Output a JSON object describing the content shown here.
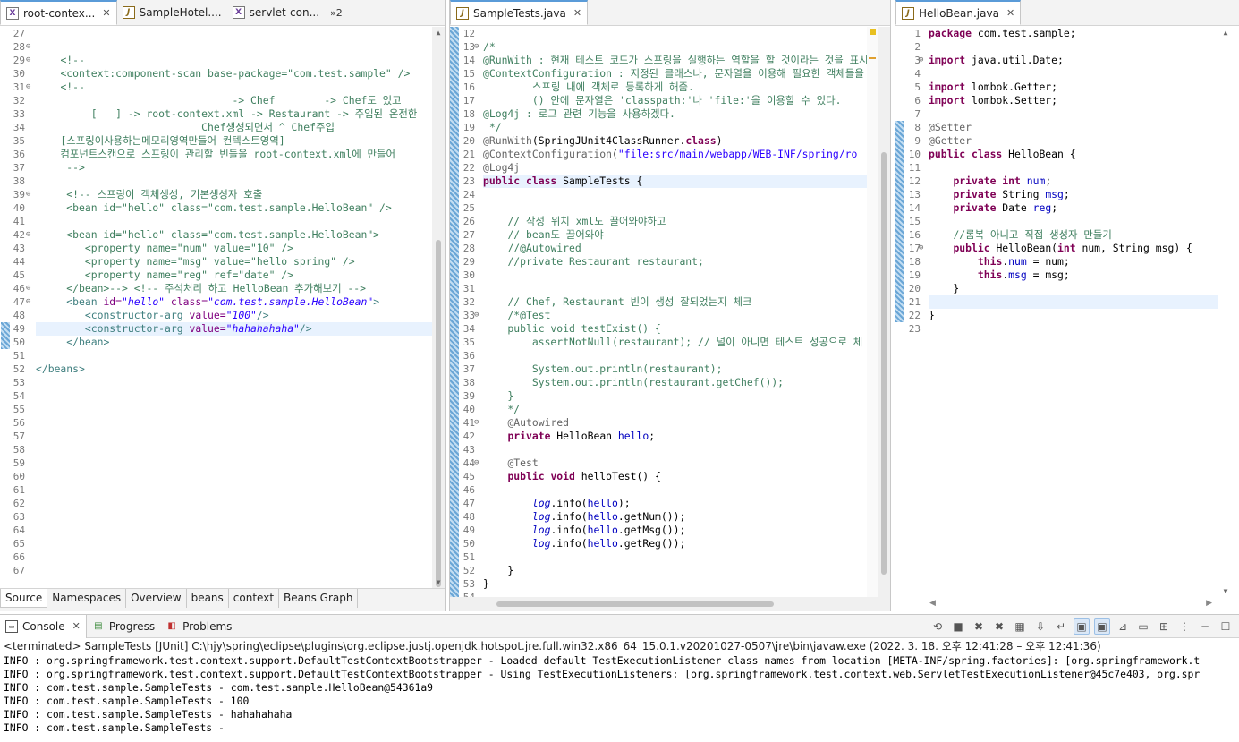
{
  "left_editor": {
    "tabs": [
      {
        "label": "root-contex...",
        "icon": "xml-file-icon",
        "active": true
      },
      {
        "label": "SampleHotel....",
        "icon": "java-file-icon",
        "active": false
      },
      {
        "label": "servlet-con...",
        "icon": "xml-file-icon",
        "active": false
      }
    ],
    "overflow_label": "»2",
    "bottom_tabs": [
      "Source",
      "Namespaces",
      "Overview",
      "beans",
      "context",
      "Beans Graph"
    ],
    "lines": [
      {
        "n": "27",
        "fold": false,
        "html": ""
      },
      {
        "n": "28",
        "fold": true,
        "html": ""
      },
      {
        "n": "29",
        "fold": true,
        "html": "    <span class='c-comment'>&lt;!--</span>"
      },
      {
        "n": "30",
        "fold": false,
        "html": "    <span class='c-comment'>&lt;context:component-scan base-package=\"com.test.sample\" /&gt;</span>"
      },
      {
        "n": "31",
        "fold": true,
        "html": "    <span class='c-comment'>&lt;!--</span>"
      },
      {
        "n": "32",
        "fold": false,
        "html": "<span class='c-comment'>                                -&gt; Chef        -&gt; Chef도 있고</span>"
      },
      {
        "n": "33",
        "fold": false,
        "html": "<span class='c-comment'>         [   ] -&gt; root-context.xml -&gt; Restaurant -&gt; 주입된 온전한</span>"
      },
      {
        "n": "34",
        "fold": false,
        "html": "<span class='c-comment'>                           Chef생성되면서 ^ Chef주입</span>"
      },
      {
        "n": "35",
        "fold": false,
        "html": "<span class='c-comment'>    [스프링이사용하는메모리영역만들어 컨텍스트영역]</span>"
      },
      {
        "n": "36",
        "fold": false,
        "html": "<span class='c-comment'>    컴포넌트스캔으로 스프링이 관리할 빈들을 root-context.xml에 만들어</span>"
      },
      {
        "n": "37",
        "fold": false,
        "html": "<span class='c-comment'>     --&gt;</span>"
      },
      {
        "n": "38",
        "fold": false,
        "html": ""
      },
      {
        "n": "39",
        "fold": true,
        "html": "     <span class='c-comment'>&lt;!-- 스프링이 객체생성, 기본생성자 호출</span>"
      },
      {
        "n": "40",
        "fold": false,
        "html": "<span class='c-comment'>     &lt;bean id=\"hello\" class=\"com.test.sample.HelloBean\" /&gt;</span>"
      },
      {
        "n": "41",
        "fold": false,
        "html": ""
      },
      {
        "n": "42",
        "fold": true,
        "html": "<span class='c-comment'>     &lt;bean id=\"hello\" class=\"com.test.sample.HelloBean\"&gt;</span>"
      },
      {
        "n": "43",
        "fold": false,
        "html": "<span class='c-comment'>        &lt;property name=\"num\" value=\"10\" /&gt;</span>"
      },
      {
        "n": "44",
        "fold": false,
        "html": "<span class='c-comment'>        &lt;property name=\"msg\" value=\"hello spring\" /&gt;</span>"
      },
      {
        "n": "45",
        "fold": false,
        "html": "<span class='c-comment'>        &lt;property name=\"reg\" ref=\"date\" /&gt;</span>"
      },
      {
        "n": "46",
        "fold": true,
        "html": "<span class='c-comment'>     &lt;/bean&gt;--&gt; &lt;!-- 주석처리 하고 HelloBean 추가해보기 --&gt;</span>"
      },
      {
        "n": "47",
        "fold": true,
        "html": "     <span class='c-tag'>&lt;bean</span> <span class='c-attr'>id=</span><span class='c-stri'>\"hello\"</span> <span class='c-attr'>class=</span><span class='c-stri'>\"com.test.sample.HelloBean\"</span><span class='c-tag'>&gt;</span>"
      },
      {
        "n": "48",
        "fold": false,
        "html": "        <span class='c-tag'>&lt;constructor-arg</span> <span class='c-attr'>value=</span><span class='c-stri'>\"100\"</span><span class='c-tag'>/&gt;</span>"
      },
      {
        "n": "49",
        "fold": false,
        "current": true,
        "html": "        <span class='c-tag'>&lt;constructor-arg</span> <span class='c-attr'>value=</span><span class='c-stri'>\"hahahahaha\"</span><span class='c-tag'>/&gt;</span>"
      },
      {
        "n": "50",
        "fold": false,
        "html": "     <span class='c-tag'>&lt;/bean&gt;</span>"
      },
      {
        "n": "51",
        "fold": false,
        "html": ""
      },
      {
        "n": "52",
        "fold": false,
        "html": "<span class='c-tag'>&lt;/beans&gt;</span>"
      },
      {
        "n": "53",
        "fold": false,
        "html": ""
      },
      {
        "n": "54",
        "fold": false,
        "html": ""
      },
      {
        "n": "55",
        "fold": false,
        "html": ""
      },
      {
        "n": "56",
        "fold": false,
        "html": ""
      },
      {
        "n": "57",
        "fold": false,
        "html": ""
      },
      {
        "n": "58",
        "fold": false,
        "html": ""
      },
      {
        "n": "59",
        "fold": false,
        "html": ""
      },
      {
        "n": "60",
        "fold": false,
        "html": ""
      },
      {
        "n": "61",
        "fold": false,
        "html": ""
      },
      {
        "n": "62",
        "fold": false,
        "html": ""
      },
      {
        "n": "63",
        "fold": false,
        "html": ""
      },
      {
        "n": "64",
        "fold": false,
        "html": ""
      },
      {
        "n": "65",
        "fold": false,
        "html": ""
      },
      {
        "n": "66",
        "fold": false,
        "html": ""
      },
      {
        "n": "67",
        "fold": false,
        "html": ""
      }
    ]
  },
  "middle_editor": {
    "tabs": [
      {
        "label": "SampleTests.java",
        "icon": "java-file-icon",
        "active": true
      }
    ],
    "lines": [
      {
        "n": "12",
        "fold": false,
        "html": ""
      },
      {
        "n": "13",
        "fold": true,
        "html": "<span class='c-comment'>/*</span>"
      },
      {
        "n": "14",
        "fold": false,
        "html": "<span class='c-comment'>@RunWith : 현재 테스트 코드가 스프링을 실행하는 역할을 할 것이라는 것을 표시함</span>"
      },
      {
        "n": "15",
        "fold": false,
        "html": "<span class='c-comment'>@ContextConfiguration : 지정된 클래스나, 문자열을 이용해 필요한 객체들을</span>"
      },
      {
        "n": "16",
        "fold": false,
        "html": "<span class='c-comment'>        스프링 내에 객체로 등록하게 해줌.</span>"
      },
      {
        "n": "17",
        "fold": false,
        "html": "<span class='c-comment'>        () 안에 문자열은 'classpath:'나 'file:'을 이용할 수 있다.</span>"
      },
      {
        "n": "18",
        "fold": false,
        "html": "<span class='c-comment'>@Log4j : 로그 관련 기능을 사용하겠다.</span>"
      },
      {
        "n": "19",
        "fold": false,
        "html": "<span class='c-comment'> */</span>"
      },
      {
        "n": "20",
        "fold": false,
        "html": "<span class='c-ann'>@RunWith</span>(SpringJUnit4ClassRunner.<span class='c-kw'>class</span>)"
      },
      {
        "n": "21",
        "fold": false,
        "html": "<span class='c-ann'>@ContextConfiguration</span>(<span class='c-str'>\"file:src/main/webapp/WEB-INF/spring/ro</span>"
      },
      {
        "n": "22",
        "fold": false,
        "html": "<span class='c-ann'>@Log4j</span>"
      },
      {
        "n": "23",
        "fold": false,
        "current": true,
        "html": "<span class='c-kw'>public class</span> SampleTests {"
      },
      {
        "n": "24",
        "fold": false,
        "html": ""
      },
      {
        "n": "25",
        "fold": false,
        "html": ""
      },
      {
        "n": "26",
        "fold": false,
        "html": "    <span class='c-comment'>// 작성 위치 xml도 끌어와야하고</span>"
      },
      {
        "n": "27",
        "fold": false,
        "html": "    <span class='c-comment'>// bean도 끌어와야</span>"
      },
      {
        "n": "28",
        "fold": false,
        "html": "    <span class='c-comment'>//@Autowired</span>"
      },
      {
        "n": "29",
        "fold": false,
        "html": "    <span class='c-comment'>//private Restaurant restaurant;</span>"
      },
      {
        "n": "30",
        "fold": false,
        "html": ""
      },
      {
        "n": "31",
        "fold": false,
        "html": ""
      },
      {
        "n": "32",
        "fold": false,
        "html": "    <span class='c-comment'>// Chef, Restaurant 빈이 생성 잘되었는지 체크</span>"
      },
      {
        "n": "33",
        "fold": true,
        "html": "    <span class='c-comment'>/*@Test</span>"
      },
      {
        "n": "34",
        "fold": false,
        "html": "<span class='c-comment'>    public void testExist() {</span>"
      },
      {
        "n": "35",
        "fold": false,
        "html": "<span class='c-comment'>        assertNotNull(restaurant); // 널이 아니면 테스트 성공으로 체</span>"
      },
      {
        "n": "36",
        "fold": false,
        "html": ""
      },
      {
        "n": "37",
        "fold": false,
        "html": "<span class='c-comment'>        System.out.println(restaurant);</span>"
      },
      {
        "n": "38",
        "fold": false,
        "html": "<span class='c-comment'>        System.out.println(restaurant.getChef());</span>"
      },
      {
        "n": "39",
        "fold": false,
        "html": "<span class='c-comment'>    }</span>"
      },
      {
        "n": "40",
        "fold": false,
        "html": "<span class='c-comment'>    */</span>"
      },
      {
        "n": "41",
        "fold": true,
        "html": "    <span class='c-ann'>@Autowired</span>"
      },
      {
        "n": "42",
        "fold": false,
        "html": "    <span class='c-kw'>private</span> HelloBean <span class='c-field'>hello</span>;"
      },
      {
        "n": "43",
        "fold": false,
        "html": ""
      },
      {
        "n": "44",
        "fold": true,
        "html": "    <span class='c-ann'>@Test</span>"
      },
      {
        "n": "45",
        "fold": false,
        "html": "    <span class='c-kw'>public void</span> helloTest() {"
      },
      {
        "n": "46",
        "fold": false,
        "html": ""
      },
      {
        "n": "47",
        "fold": false,
        "html": "        <span class='c-field c-italic'>log</span>.info(<span class='c-field'>hello</span>);"
      },
      {
        "n": "48",
        "fold": false,
        "html": "        <span class='c-field c-italic'>log</span>.info(<span class='c-field'>hello</span>.getNum());"
      },
      {
        "n": "49",
        "fold": false,
        "html": "        <span class='c-field c-italic'>log</span>.info(<span class='c-field'>hello</span>.getMsg());"
      },
      {
        "n": "50",
        "fold": false,
        "html": "        <span class='c-field c-italic'>log</span>.info(<span class='c-field'>hello</span>.getReg());"
      },
      {
        "n": "51",
        "fold": false,
        "html": ""
      },
      {
        "n": "52",
        "fold": false,
        "html": "    }"
      },
      {
        "n": "53",
        "fold": false,
        "html": "}"
      },
      {
        "n": "54",
        "fold": false,
        "html": ""
      }
    ]
  },
  "right_editor": {
    "tabs": [
      {
        "label": "HelloBean.java",
        "icon": "java-file-icon",
        "active": true
      }
    ],
    "lines": [
      {
        "n": "1",
        "fold": false,
        "html": "<span class='c-kw'>package</span> com.test.sample;"
      },
      {
        "n": "2",
        "fold": false,
        "html": ""
      },
      {
        "n": "3",
        "fold": true,
        "html": "<span class='c-kw'>import</span> java.util.Date;"
      },
      {
        "n": "4",
        "fold": false,
        "html": ""
      },
      {
        "n": "5",
        "fold": false,
        "html": "<span class='c-kw'>import</span> lombok.Getter;"
      },
      {
        "n": "6",
        "fold": false,
        "html": "<span class='c-kw'>import</span> lombok.Setter;"
      },
      {
        "n": "7",
        "fold": false,
        "html": ""
      },
      {
        "n": "8",
        "fold": false,
        "html": "<span class='c-ann'>@Setter</span>"
      },
      {
        "n": "9",
        "fold": false,
        "html": "<span class='c-ann'>@Getter</span>"
      },
      {
        "n": "10",
        "fold": false,
        "html": "<span class='c-kw'>public class</span> HelloBean {"
      },
      {
        "n": "11",
        "fold": false,
        "html": ""
      },
      {
        "n": "12",
        "fold": false,
        "html": "    <span class='c-kw'>private int</span> <span class='c-field'>num</span>;"
      },
      {
        "n": "13",
        "fold": false,
        "html": "    <span class='c-kw'>private</span> String <span class='c-field'>msg</span>;"
      },
      {
        "n": "14",
        "fold": false,
        "html": "    <span class='c-kw'>private</span> Date <span class='c-field'>reg</span>;"
      },
      {
        "n": "15",
        "fold": false,
        "html": ""
      },
      {
        "n": "16",
        "fold": false,
        "html": "    <span class='c-comment'>//롬복 아니고 직접 생성자 만들기</span>"
      },
      {
        "n": "17",
        "fold": true,
        "html": "    <span class='c-kw'>public</span> HelloBean(<span class='c-kw'>int</span> num, String msg) {"
      },
      {
        "n": "18",
        "fold": false,
        "html": "        <span class='c-kw'>this</span>.<span class='c-field'>num</span> = num;"
      },
      {
        "n": "19",
        "fold": false,
        "html": "        <span class='c-kw'>this</span>.<span class='c-field'>msg</span> = msg;"
      },
      {
        "n": "20",
        "fold": false,
        "html": "    }"
      },
      {
        "n": "21",
        "fold": false,
        "current": true,
        "html": ""
      },
      {
        "n": "22",
        "fold": false,
        "html": "}"
      },
      {
        "n": "23",
        "fold": false,
        "html": ""
      }
    ]
  },
  "console": {
    "tabs": [
      {
        "label": "Console",
        "icon": "console-icon",
        "active": true
      },
      {
        "label": "Progress",
        "icon": "progress-icon",
        "active": false
      },
      {
        "label": "Problems",
        "icon": "problems-icon",
        "active": false
      }
    ],
    "status": "<terminated> SampleTests [JUnit] C:\\hjy\\spring\\eclipse\\plugins\\org.eclipse.justj.openjdk.hotspot.jre.full.win32.x86_64_15.0.1.v20201027-0507\\jre\\bin\\javaw.exe  (2022. 3. 18. 오후 12:41:28 – 오후 12:41:36)",
    "output": [
      "INFO : org.springframework.test.context.support.DefaultTestContextBootstrapper - Loaded default TestExecutionListener class names from location [META-INF/spring.factories]: [org.springframework.t",
      "INFO : org.springframework.test.context.support.DefaultTestContextBootstrapper - Using TestExecutionListeners: [org.springframework.test.context.web.ServletTestExecutionListener@45c7e403, org.spr",
      "INFO : com.test.sample.SampleTests - com.test.sample.HelloBean@54361a9",
      "INFO : com.test.sample.SampleTests - 100",
      "INFO : com.test.sample.SampleTests - hahahahaha",
      "INFO : com.test.sample.SampleTests - "
    ],
    "toolbar_icons": [
      "remove-launch-icon",
      "terminate-icon",
      "remove-icon",
      "remove-all-icon",
      "clear-console-icon",
      "scroll-lock-icon",
      "word-wrap-icon",
      "show-on-stdout-icon",
      "show-on-stderr-icon",
      "pin-console-icon",
      "display-console-icon",
      "open-console-icon",
      "view-menu-icon",
      "minimize-icon",
      "maximize-icon"
    ]
  }
}
